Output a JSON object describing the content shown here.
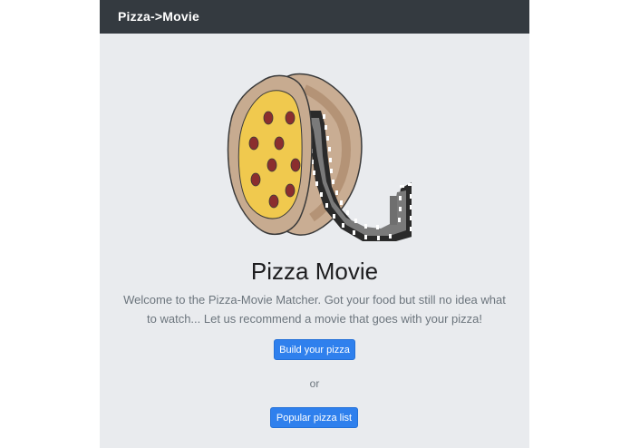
{
  "navbar": {
    "brand": "Pizza->Movie"
  },
  "hero": {
    "logo_icon": "pizza-film-reel-icon",
    "title": "Pizza Movie",
    "description": "Welcome to the Pizza-Movie Matcher. Got your food but still no idea what to watch... Let us recommend a movie that goes with your pizza!"
  },
  "actions": {
    "build_label": "Build your pizza",
    "or_label": "or",
    "popular_label": "Popular pizza list"
  },
  "colors": {
    "navbar_bg": "#343a40",
    "page_bg": "#e9ebee",
    "button_primary": "#2f80ed",
    "pizza_crust": "#c9a98b",
    "pizza_cheese": "#f0c94e",
    "pepperoni": "#8b2e2e"
  }
}
